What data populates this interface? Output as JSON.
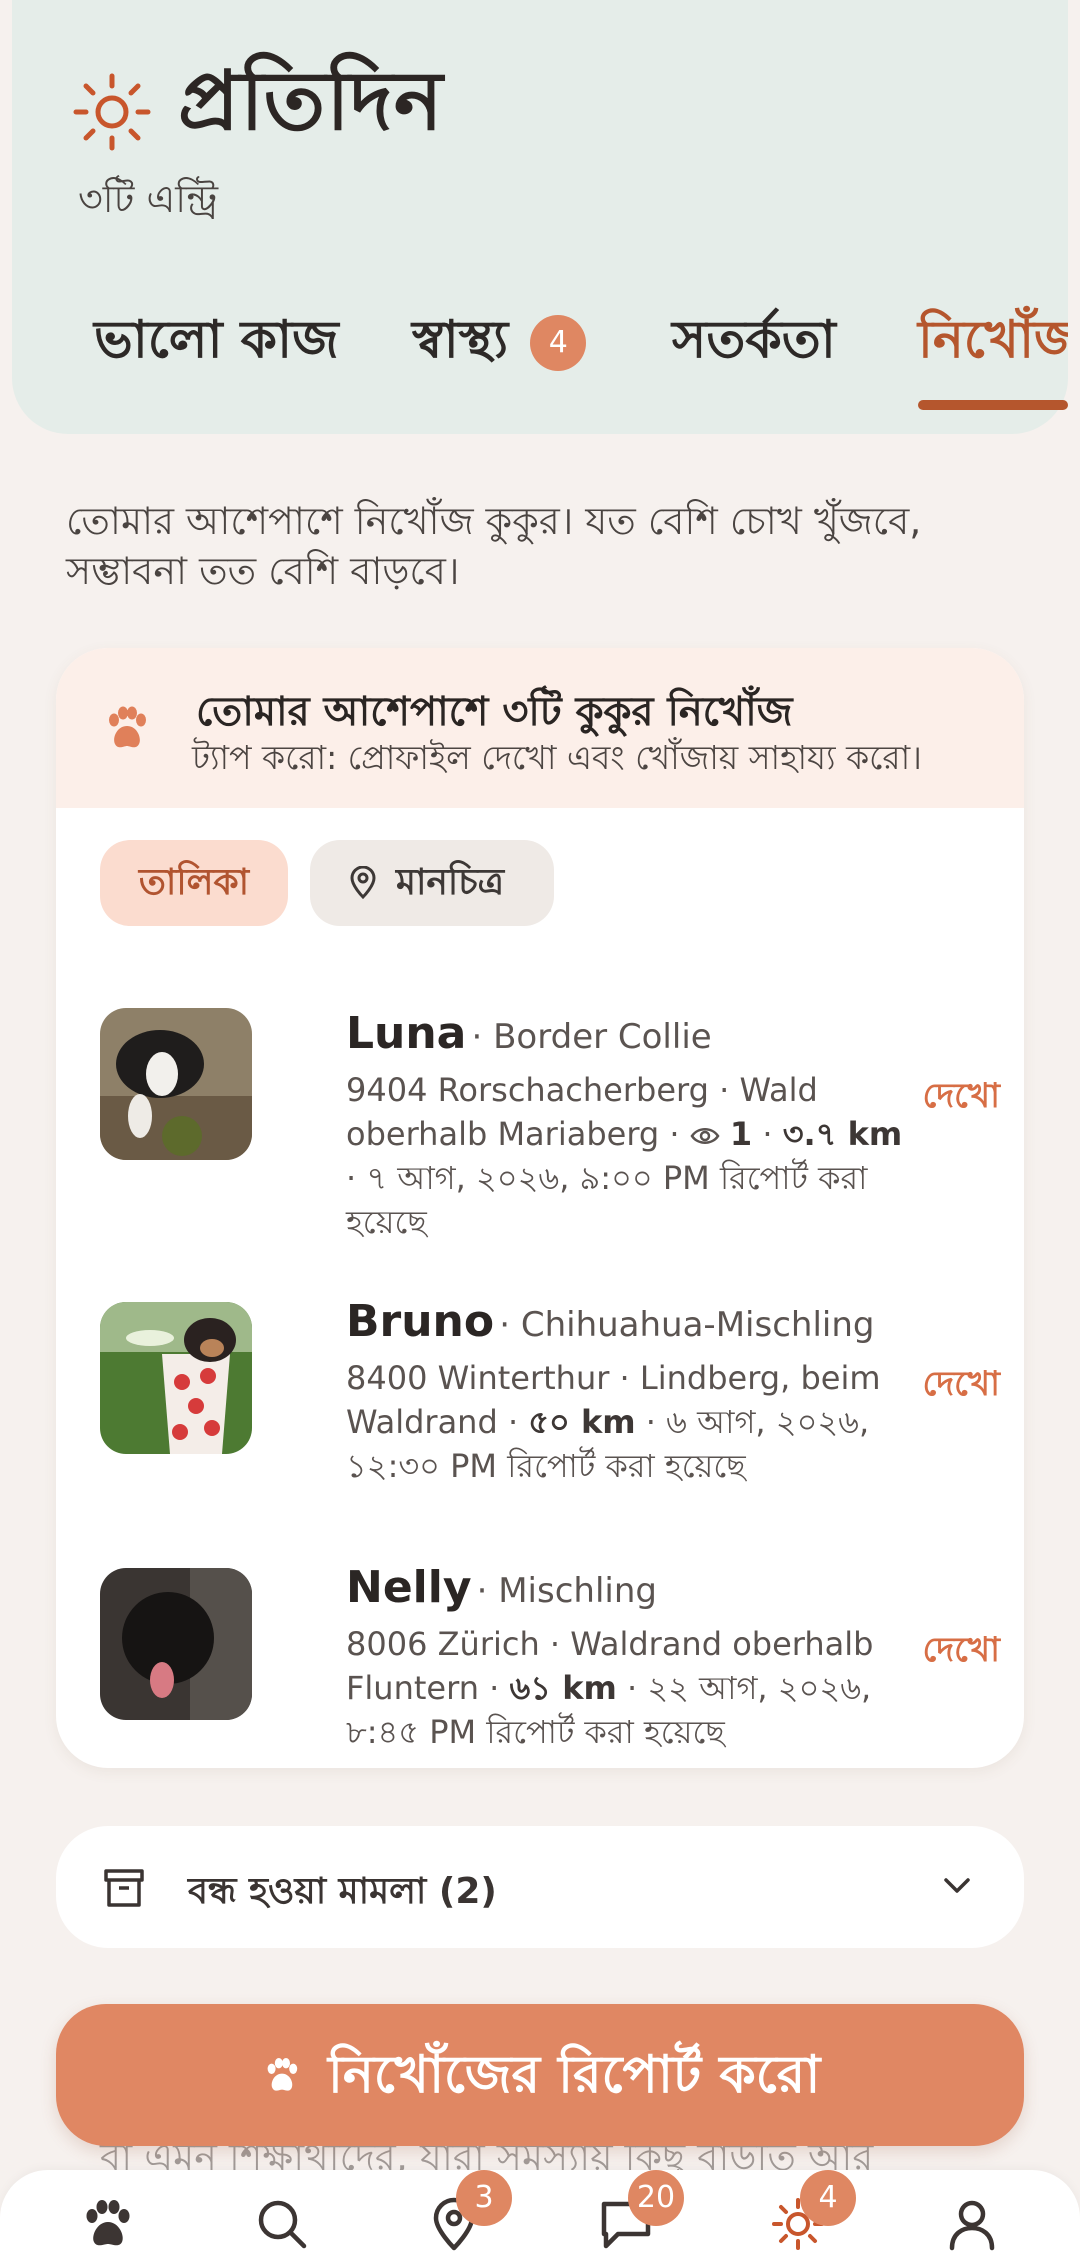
{
  "header": {
    "title": "প্রতিদিন",
    "subtitle": "৩টি এন্ট্রি",
    "tabs": [
      {
        "label": "ভালো কাজ"
      },
      {
        "label": "স্বাস্থ্য",
        "badge": "4"
      },
      {
        "label": "সতর্কতা"
      },
      {
        "label": "নিখোঁজ",
        "active": true
      }
    ]
  },
  "intro": "তোমার আশেপাশে নিখোঁজ কুকুর। যত বেশি চোখ খুঁজবে, সম্ভাবনা তত বেশি বাড়বে।",
  "card": {
    "title": "তোমার আশেপাশে ৩টি কুকুর নিখোঁজ",
    "subtitle": "ট্যাপ করো: প্রোফাইল দেখো এবং খোঁজায় সাহায্য করো।",
    "segments": {
      "list": "তালিকা",
      "map": "মানচিত্র",
      "selected": "list"
    },
    "items": [
      {
        "name": "Luna",
        "breed": "· Border Collie",
        "desc_a": "9404 Rorschacherberg · Wald oberhalb Mariaberg · ",
        "views": "1",
        "sep": " · ",
        "distance": "৩.৭ km",
        "desc_b": " · ৭ আগ, ২০২৬, ৯:০০ PM রিপোর্ট করা হয়েছে",
        "action": "দেখো"
      },
      {
        "name": "Bruno",
        "breed": "· Chihuahua-Mischling",
        "desc_a": "8400 Winterthur · Lindberg, beim Waldrand · ",
        "distance": "৫০ km",
        "desc_b": " · ৬ আগ, ২০২৬, ১২:৩০ PM রিপোর্ট করা হয়েছে",
        "action": "দেখো"
      },
      {
        "name": "Nelly",
        "breed": "· Mischling",
        "desc_a": "8006 Zürich · Waldrand oberhalb Fluntern · ",
        "distance": "৬১ km",
        "desc_b": " · ২২ আগ, ২০২৬, ৮:৪৫ PM রিপোর্ট করা হয়েছে",
        "action": "দেখো"
      }
    ]
  },
  "closed": {
    "label": "বন্ধ হওয়া মামলা (2)"
  },
  "report_button": "নিখোঁজের রিপোর্ট করো",
  "ghost_text": "বা এমন শিক্ষার্থীদের, যারা সমস্যায় কিছু বাড়তি আর",
  "nav": [
    {
      "icon": "paw-icon"
    },
    {
      "icon": "search-icon"
    },
    {
      "icon": "location-pin-icon",
      "badge": "3"
    },
    {
      "icon": "chat-icon",
      "badge": "20"
    },
    {
      "icon": "sun-icon",
      "badge": "4"
    },
    {
      "icon": "profile-icon"
    }
  ],
  "colors": {
    "accent": "#df8762",
    "accent_dark": "#b5562d",
    "header_bg": "#e5ede9"
  }
}
